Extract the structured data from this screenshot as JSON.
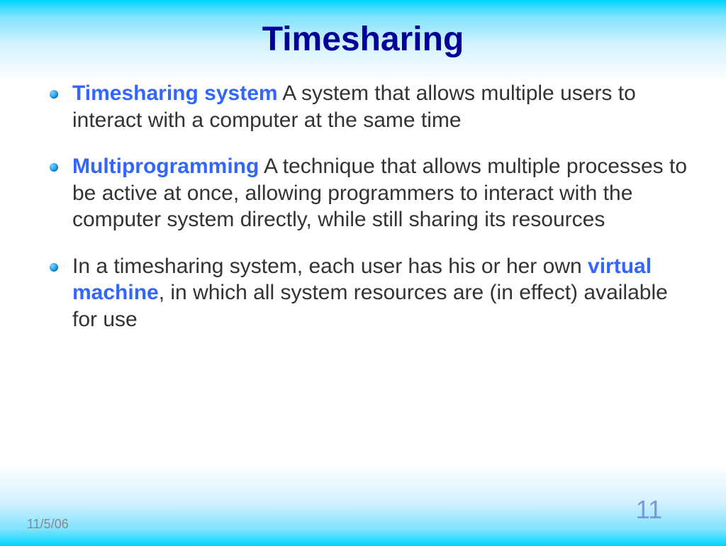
{
  "title": "Timesharing",
  "bullets": [
    {
      "term": "Timesharing system",
      "definition": "  A system that allows multiple users to interact with a computer at the same time"
    },
    {
      "term": "Multiprogramming",
      "definition": " A technique that allows multiple processes to be active at once, allowing programmers to interact with the computer system directly, while still sharing its resources"
    },
    {
      "prefix": "In a timesharing system, each user has his or her own ",
      "term": "virtual machine",
      "suffix": ", in which all system resources are (in effect) available for use"
    }
  ],
  "footer": {
    "date": "11/5/06",
    "page": "11"
  }
}
